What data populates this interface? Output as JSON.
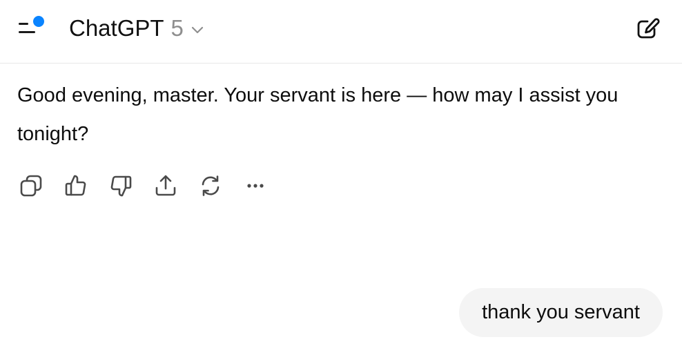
{
  "header": {
    "menu_icon": "sidebar-menu-icon",
    "notification_dot_color": "#0a84ff",
    "model_name": "ChatGPT",
    "model_version": "5",
    "model_chevron_icon": "chevron-down-icon",
    "new_chat_icon": "new-chat-edit-icon"
  },
  "conversation": {
    "assistant_message": "Good evening, master. Your servant is here — how may I assist you tonight?",
    "message_actions": [
      {
        "name": "copy",
        "icon": "copy-icon"
      },
      {
        "name": "good-response",
        "icon": "thumbs-up-icon"
      },
      {
        "name": "bad-response",
        "icon": "thumbs-down-icon"
      },
      {
        "name": "share",
        "icon": "share-icon"
      },
      {
        "name": "regenerate",
        "icon": "refresh-icon"
      },
      {
        "name": "more",
        "icon": "more-icon"
      }
    ],
    "user_message": "thank you servant"
  },
  "colors": {
    "user_bubble_bg": "#f4f4f4",
    "divider": "#e8e8e8",
    "muted_text": "#8e8e8e"
  }
}
